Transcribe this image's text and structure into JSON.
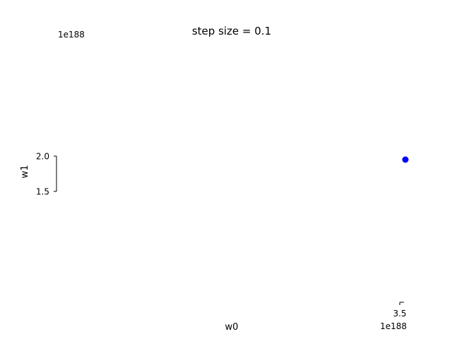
{
  "chart_data": {
    "type": "scatter",
    "title": "step size = 0.1",
    "xlabel": "w0",
    "ylabel": "w1",
    "x_offset_text": "1e188",
    "y_offset_text": "1e188",
    "x_ticks": [
      {
        "value": 3.5,
        "label": "3.5"
      }
    ],
    "y_ticks": [
      {
        "value": 1.5,
        "label": "1.5"
      },
      {
        "value": 2.0,
        "label": "2.0"
      }
    ],
    "points": [
      {
        "x": 3.5,
        "y": 1.95
      }
    ],
    "point_color": "#0000ff",
    "grid": false
  }
}
